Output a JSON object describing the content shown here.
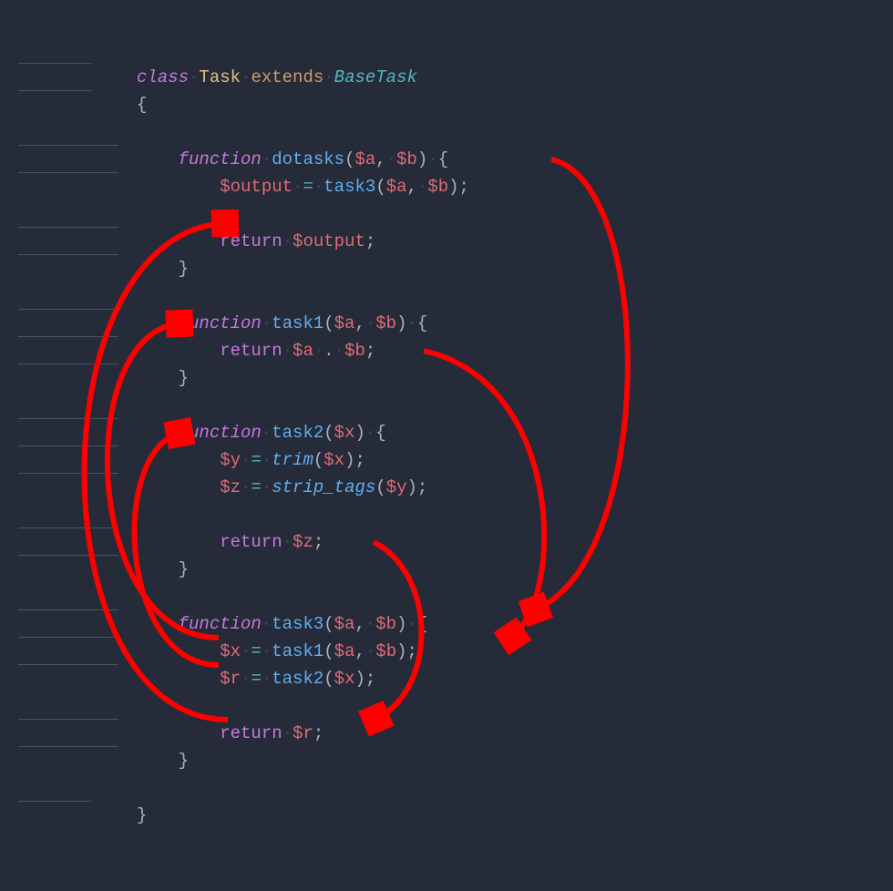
{
  "code": {
    "keywords": {
      "class": "class",
      "extends": "extends",
      "function": "function",
      "return": "return"
    },
    "declarations": {
      "class_name": "Task",
      "base_class": "BaseTask"
    },
    "functions": {
      "dotasks": {
        "name": "dotasks",
        "params": [
          "$a",
          "$b"
        ],
        "assign_var": "$output",
        "calls": "task3",
        "call_args": [
          "$a",
          "$b"
        ],
        "returns": "$output"
      },
      "task1": {
        "name": "task1",
        "params": [
          "$a",
          "$b"
        ],
        "returns_expr": {
          "left": "$a",
          "op": ".",
          "right": "$b"
        }
      },
      "task2": {
        "name": "task2",
        "params": [
          "$x"
        ],
        "line1": {
          "var": "$y",
          "fn": "trim",
          "arg": "$x"
        },
        "line2": {
          "var": "$z",
          "fn": "strip_tags",
          "arg": "$y"
        },
        "returns": "$z"
      },
      "task3": {
        "name": "task3",
        "params": [
          "$a",
          "$b"
        ],
        "line1": {
          "var": "$x",
          "fn": "task1",
          "args": [
            "$a",
            "$b"
          ]
        },
        "line2": {
          "var": "$r",
          "fn": "task2",
          "arg": "$x"
        },
        "returns": "$r"
      }
    }
  },
  "arrows_description": [
    "task3 call in dotasks → function task3 declaration",
    "task1 call in task3 → function task1 declaration",
    "task2 call in task3 → function task2 declaration",
    "return $r in task3 → return $output in dotasks (via $output = task3 line)",
    "return $a.$b in task1 → $x = task1 line in task3"
  ]
}
